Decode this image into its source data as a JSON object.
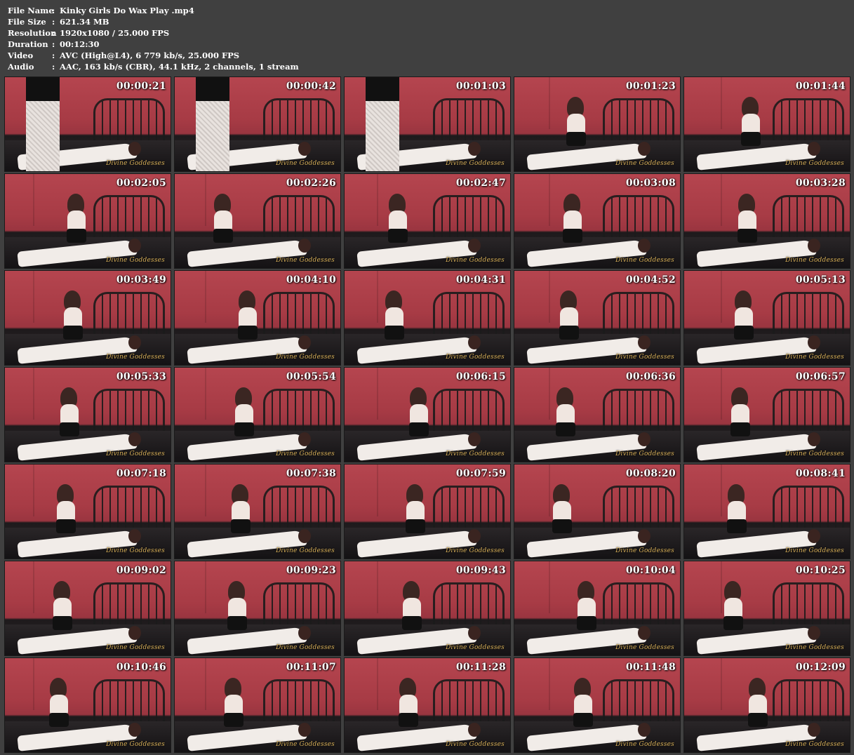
{
  "info": [
    {
      "label": "File Name",
      "value": "Kinky Girls Do Wax Play .mp4"
    },
    {
      "label": "File Size",
      "value": "621.34 MB"
    },
    {
      "label": "Resolution",
      "value": "1920x1080 / 25.000 FPS"
    },
    {
      "label": "Duration",
      "value": "00:12:30"
    },
    {
      "label": "Video",
      "value": "AVC (High@L4), 6 779 kb/s, 25.000 FPS"
    },
    {
      "label": "Audio",
      "value": "AAC, 163 kb/s (CBR), 44.1 kHz, 2 channels, 1 stream"
    }
  ],
  "separator": ":",
  "thumbnails": [
    {
      "time": "00:00:21",
      "pose": "standing"
    },
    {
      "time": "00:00:42",
      "pose": "standing"
    },
    {
      "time": "00:01:03",
      "pose": "standing"
    },
    {
      "time": "00:01:23",
      "pose": "kneel"
    },
    {
      "time": "00:01:44",
      "pose": "kneel"
    },
    {
      "time": "00:02:05",
      "pose": "kneel"
    },
    {
      "time": "00:02:26",
      "pose": "kneel"
    },
    {
      "time": "00:02:47",
      "pose": "kneel"
    },
    {
      "time": "00:03:08",
      "pose": "kneel"
    },
    {
      "time": "00:03:28",
      "pose": "kneel"
    },
    {
      "time": "00:03:49",
      "pose": "kneel"
    },
    {
      "time": "00:04:10",
      "pose": "kneel"
    },
    {
      "time": "00:04:31",
      "pose": "kneel"
    },
    {
      "time": "00:04:52",
      "pose": "kneel"
    },
    {
      "time": "00:05:13",
      "pose": "kneel"
    },
    {
      "time": "00:05:33",
      "pose": "kneel"
    },
    {
      "time": "00:05:54",
      "pose": "kneel"
    },
    {
      "time": "00:06:15",
      "pose": "kneel"
    },
    {
      "time": "00:06:36",
      "pose": "kneel"
    },
    {
      "time": "00:06:57",
      "pose": "kneel"
    },
    {
      "time": "00:07:18",
      "pose": "kneel"
    },
    {
      "time": "00:07:38",
      "pose": "kneel"
    },
    {
      "time": "00:07:59",
      "pose": "kneel"
    },
    {
      "time": "00:08:20",
      "pose": "kneel"
    },
    {
      "time": "00:08:41",
      "pose": "kneel"
    },
    {
      "time": "00:09:02",
      "pose": "kneel"
    },
    {
      "time": "00:09:23",
      "pose": "kneel"
    },
    {
      "time": "00:09:43",
      "pose": "kneel"
    },
    {
      "time": "00:10:04",
      "pose": "kneel"
    },
    {
      "time": "00:10:25",
      "pose": "kneel"
    },
    {
      "time": "00:10:46",
      "pose": "kneel"
    },
    {
      "time": "00:11:07",
      "pose": "kneel"
    },
    {
      "time": "00:11:28",
      "pose": "kneel"
    },
    {
      "time": "00:11:48",
      "pose": "kneel"
    },
    {
      "time": "00:12:09",
      "pose": "kneel"
    }
  ],
  "watermark": "Divine Goddesses",
  "colors": {
    "background": "#404040",
    "wall": "#a83a44",
    "text": "#ffffff",
    "watermark": "#d8b05a"
  }
}
